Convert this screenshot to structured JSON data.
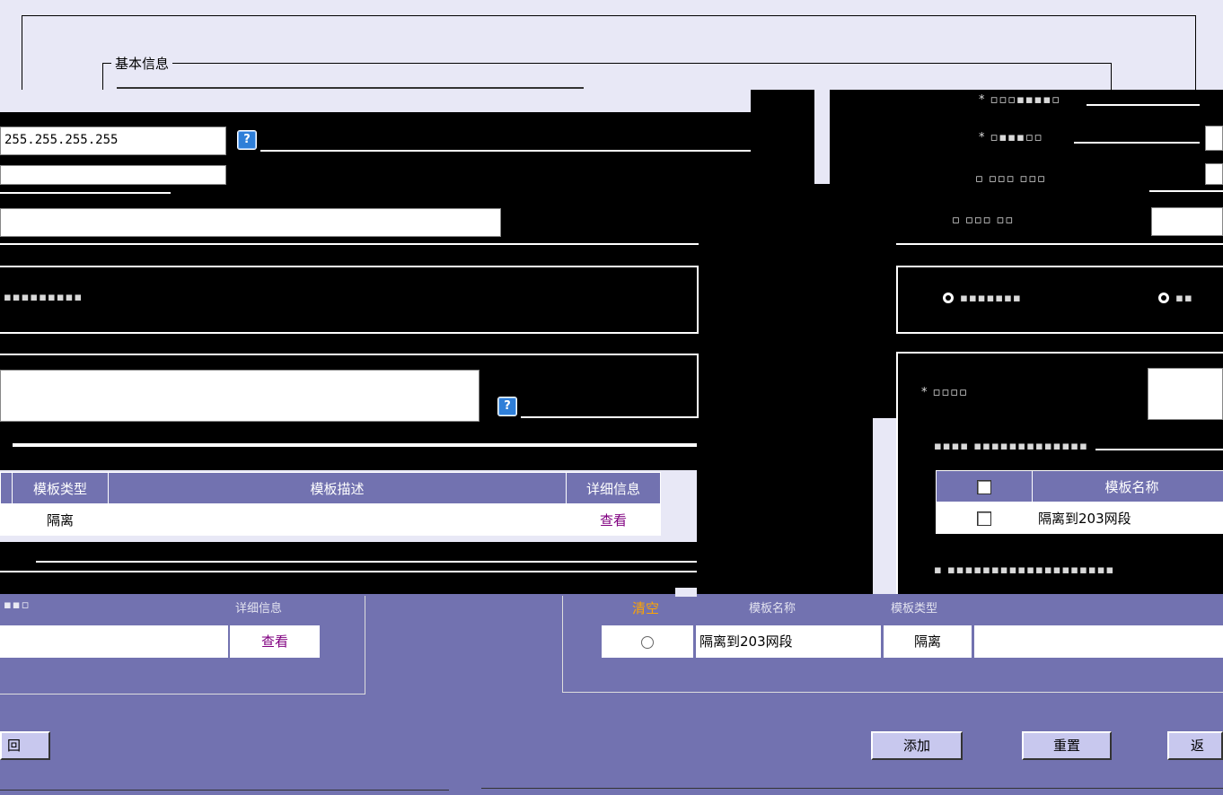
{
  "fieldset": {
    "legend": "基本信息"
  },
  "fields": {
    "ip_value": "255.255.255.255"
  },
  "help": {
    "glyph": "?"
  },
  "left_table": {
    "headers": [
      "模板类型",
      "模板描述",
      "详细信息"
    ],
    "row": {
      "type": "隔离",
      "desc": "",
      "detail": "查看"
    }
  },
  "lower_left_table": {
    "header_detail": "详细信息",
    "row": {
      "detail": "查看"
    }
  },
  "right_table": {
    "headers": [
      "模板名称"
    ],
    "row": {
      "name": "隔离到203网段"
    }
  },
  "lower_right_table": {
    "headers": [
      "清空",
      "模板名称",
      "模板类型"
    ],
    "row": {
      "name": "隔离到203网段",
      "type": "隔离",
      "desc": ""
    }
  },
  "buttons": {
    "back_left": "回",
    "add": "添加",
    "reset": "重置",
    "back_right": "返"
  },
  "colors": {
    "accent": "#7272b0",
    "header_warn": "#ffa500",
    "link": "#800080"
  }
}
